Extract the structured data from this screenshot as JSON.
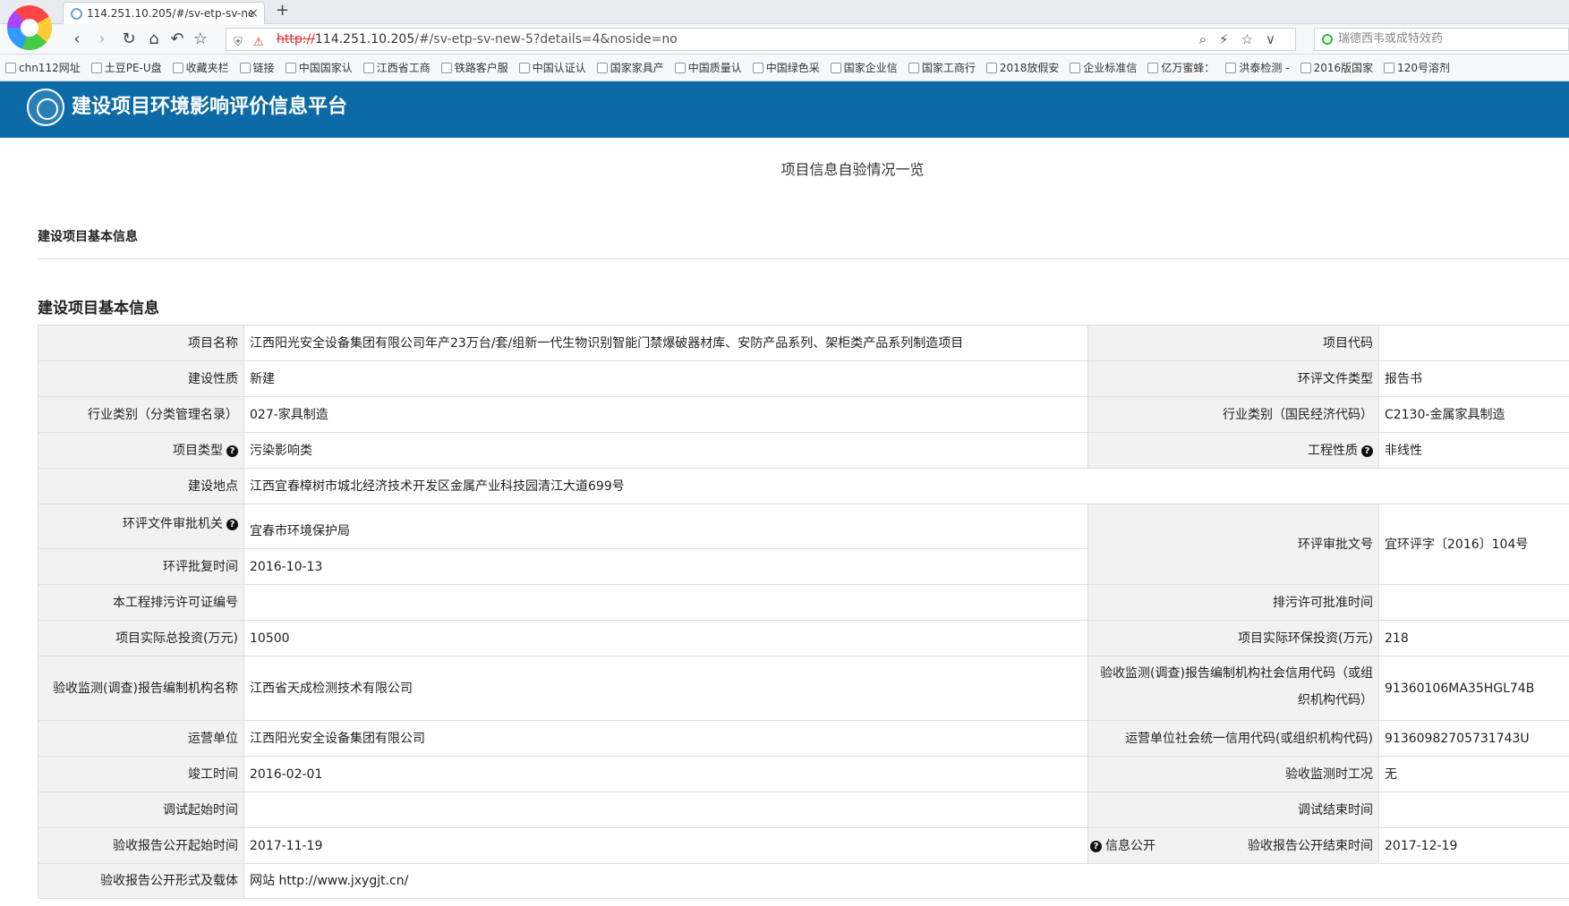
{
  "browser": {
    "tab_title": "114.251.10.205/#/sv-etp-sv-ne",
    "url_scheme": "http://",
    "url_host": "114.251.10.205",
    "url_path": "/#/sv-etp-sv-new-5?details=4&noside=no",
    "search_placeholder": "瑞德西韦或成特效药"
  },
  "bookmarks": [
    "chn112网址",
    "土豆PE-U盘",
    "收藏夹栏",
    "链接",
    "中国国家认",
    "江西省工商",
    "铁路客户服",
    "中国认证认",
    "国家家具产",
    "中国质量认",
    "中国绿色采",
    "国家企业信",
    "国家工商行",
    "2018放假安",
    "企业标准信",
    "亿万蜜蜂：",
    "洪泰检测 -",
    "2016版国家",
    "120号溶剂"
  ],
  "site": {
    "title": "建设项目环境影响评价信息平台"
  },
  "page": {
    "title": "项目信息自验情况一览",
    "section_small": "建设项目基本信息",
    "section_big": "建设项目基本信息",
    "info_open_label": "信息公开"
  },
  "table": {
    "project_name_label": "项目名称",
    "project_name": "江西阳光安全设备集团有限公司年产23万台/套/组新一代生物识别智能门禁爆破器材库、安防产品系列、架柜类产品系列制造项目",
    "project_code_label": "项目代码",
    "project_code": "",
    "nature_label": "建设性质",
    "nature": "新建",
    "eia_doc_type_label": "环评文件类型",
    "eia_doc_type": "报告书",
    "industry_mgmt_label": "行业类别（分类管理名录）",
    "industry_mgmt": "027-家具制造",
    "industry_nat_label": "行业类别（国民经济代码）",
    "industry_nat": "C2130-金属家具制造",
    "project_type_label": "项目类型",
    "project_type": "污染影响类",
    "eng_nature_label": "工程性质",
    "eng_nature": "非线性",
    "location_label": "建设地点",
    "location": "江西宜春樟树市城北经济技术开发区金属产业科技园清江大道699号",
    "approval_org_label": "环评文件审批机关",
    "approval_org": "宜春市环境保护局",
    "approval_no_label": "环评审批文号",
    "approval_no": "宜环评字〔2016〕104号",
    "approval_time_label": "环评批复时间",
    "approval_time": "2016-10-13",
    "permit_no_label": "本工程排污许可证编号",
    "permit_no": "",
    "permit_time_label": "排污许可批准时间",
    "permit_time": "",
    "total_invest_label": "项目实际总投资(万元)",
    "total_invest": "10500",
    "env_invest_label": "项目实际环保投资(万元)",
    "env_invest": "218",
    "report_org_label": "验收监测(调查)报告编制机构名称",
    "report_org": "江西省天成检测技术有限公司",
    "report_org_code_label": "验收监测(调查)报告编制机构社会信用代码（或组织机构代码）",
    "report_org_code": "91360106MA35HGL74B",
    "operator_label": "运营单位",
    "operator": "江西阳光安全设备集团有限公司",
    "operator_code_label": "运营单位社会统一信用代码(或组织机构代码)",
    "operator_code": "91360982705731743U",
    "completion_label": "竣工时间",
    "completion": "2016-02-01",
    "monitor_cond_label": "验收监测时工况",
    "monitor_cond": "无",
    "debug_start_label": "调试起始时间",
    "debug_start": "",
    "debug_end_label": "调试结束时间",
    "debug_end": "",
    "pub_start_label": "验收报告公开起始时间",
    "pub_start": "2017-11-19",
    "pub_end_label": "验收报告公开结束时间",
    "pub_end": "2017-12-19",
    "pub_form_label": "验收报告公开形式及载体",
    "pub_form": "网站  http://www.jxygjt.cn/"
  }
}
